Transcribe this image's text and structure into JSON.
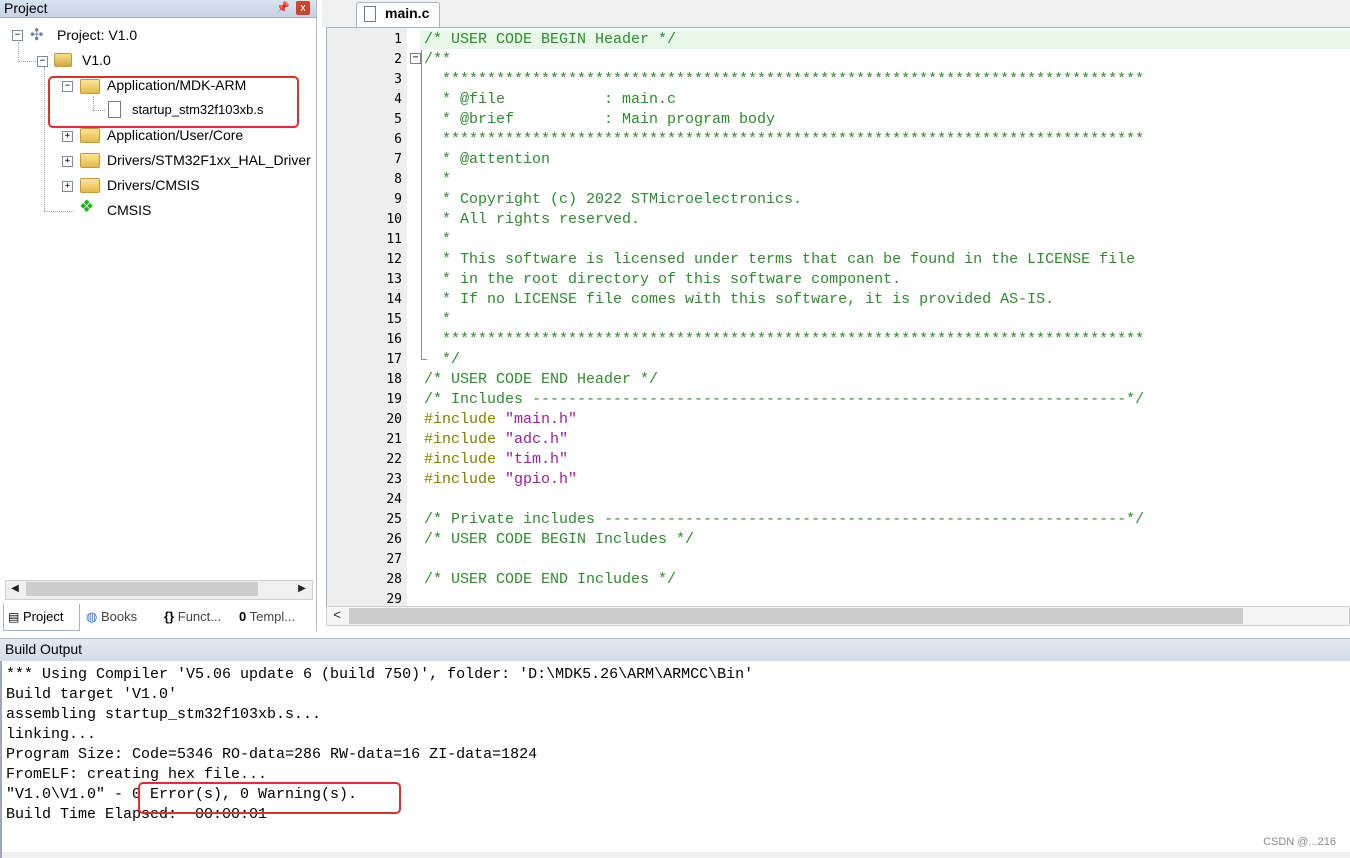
{
  "project_panel": {
    "title": "Project",
    "pin": "ᵖ",
    "close": "x",
    "tree": {
      "root": "Project: V1.0",
      "target": "V1.0",
      "groups": [
        {
          "label": "Application/MDK-ARM",
          "expanded": true,
          "children": [
            "startup_stm32f103xb.s"
          ]
        },
        {
          "label": "Application/User/Core",
          "expanded": false
        },
        {
          "label": "Drivers/STM32F1xx_HAL_Driver",
          "expanded": false
        },
        {
          "label": "Drivers/CMSIS",
          "expanded": false
        }
      ],
      "component": "CMSIS"
    },
    "tabs": [
      {
        "label": "Project",
        "icon": "project-icon"
      },
      {
        "label": "Books",
        "icon": "books-icon"
      },
      {
        "label": "Funct...",
        "icon": "functions-icon",
        "glyph": "{}"
      },
      {
        "label": "Templ...",
        "icon": "templates-icon",
        "glyph": "0"
      }
    ]
  },
  "editor": {
    "tab": "main.c",
    "lines": [
      {
        "n": "1",
        "text": "/* USER CODE BEGIN Header */",
        "color": "green"
      },
      {
        "n": "2",
        "text": "/**",
        "color": "green"
      },
      {
        "n": "3",
        "text": "  ******************************************************************************",
        "color": "green"
      },
      {
        "n": "4",
        "text": "  * @file           : main.c",
        "color": "green"
      },
      {
        "n": "5",
        "text": "  * @brief          : Main program body",
        "color": "green"
      },
      {
        "n": "6",
        "text": "  ******************************************************************************",
        "color": "green"
      },
      {
        "n": "7",
        "text": "  * @attention",
        "color": "green"
      },
      {
        "n": "8",
        "text": "  *",
        "color": "green"
      },
      {
        "n": "9",
        "text": "  * Copyright (c) 2022 STMicroelectronics.",
        "color": "green"
      },
      {
        "n": "10",
        "text": "  * All rights reserved.",
        "color": "green"
      },
      {
        "n": "11",
        "text": "  *",
        "color": "green"
      },
      {
        "n": "12",
        "text": "  * This software is licensed under terms that can be found in the LICENSE file",
        "color": "green"
      },
      {
        "n": "13",
        "text": "  * in the root directory of this software component.",
        "color": "green"
      },
      {
        "n": "14",
        "text": "  * If no LICENSE file comes with this software, it is provided AS-IS.",
        "color": "green"
      },
      {
        "n": "15",
        "text": "  *",
        "color": "green"
      },
      {
        "n": "16",
        "text": "  ******************************************************************************",
        "color": "green"
      },
      {
        "n": "17",
        "text": "  */",
        "color": "green"
      },
      {
        "n": "18",
        "text": "/* USER CODE END Header */",
        "color": "green"
      },
      {
        "n": "19",
        "text": "/* Includes ------------------------------------------------------------------*/",
        "color": "green"
      },
      {
        "n": "20",
        "directive": "#include",
        "string": "\"main.h\""
      },
      {
        "n": "21",
        "directive": "#include",
        "string": "\"adc.h\""
      },
      {
        "n": "22",
        "directive": "#include",
        "string": "\"tim.h\""
      },
      {
        "n": "23",
        "directive": "#include",
        "string": "\"gpio.h\""
      },
      {
        "n": "24",
        "text": "",
        "color": "green"
      },
      {
        "n": "25",
        "text": "/* Private includes ----------------------------------------------------------*/",
        "color": "green"
      },
      {
        "n": "26",
        "text": "/* USER CODE BEGIN Includes */",
        "color": "green"
      },
      {
        "n": "27",
        "text": "",
        "color": "green"
      },
      {
        "n": "28",
        "text": "/* USER CODE END Includes */",
        "color": "green"
      },
      {
        "n": "29",
        "text": "",
        "color": "green"
      }
    ],
    "colors": {
      "comment": "#2e8b2e",
      "directive": "#808000",
      "string": "#9b209b"
    }
  },
  "build_output": {
    "title": "Build Output",
    "lines": [
      "*** Using Compiler 'V5.06 update 6 (build 750)', folder: 'D:\\MDK5.26\\ARM\\ARMCC\\Bin'",
      "Build target 'V1.0'",
      "assembling startup_stm32f103xb.s...",
      "linking...",
      "Program Size: Code=5346 RO-data=286 RW-data=16 ZI-data=1824",
      "FromELF: creating hex file...",
      "\"V1.0\\V1.0\" - 0 Error(s), 0 Warning(s).",
      "Build Time Elapsed:  00:00:01"
    ]
  },
  "watermark": "CSDN @...216",
  "annotation_color": "#e52b2b"
}
